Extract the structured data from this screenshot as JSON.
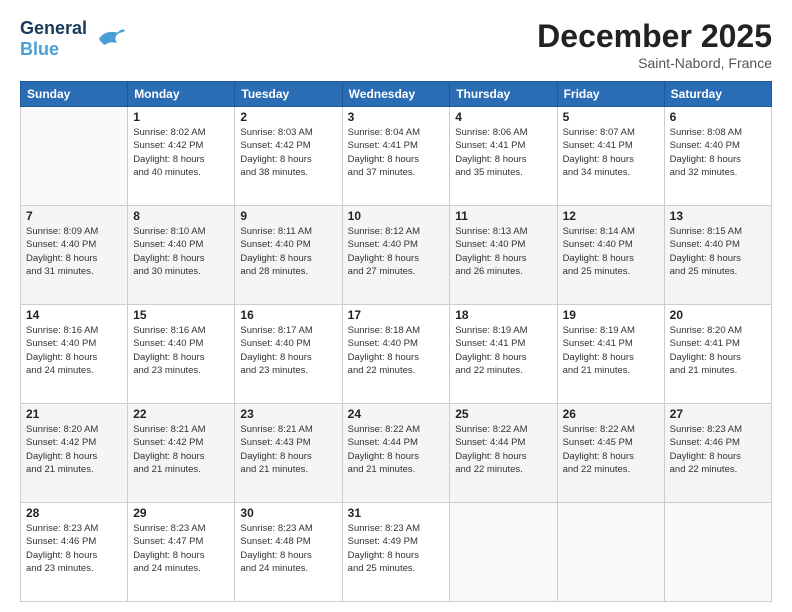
{
  "header": {
    "logo_line1": "General",
    "logo_line2": "Blue",
    "month": "December 2025",
    "location": "Saint-Nabord, France"
  },
  "weekdays": [
    "Sunday",
    "Monday",
    "Tuesday",
    "Wednesday",
    "Thursday",
    "Friday",
    "Saturday"
  ],
  "weeks": [
    [
      {
        "day": "",
        "info": ""
      },
      {
        "day": "1",
        "info": "Sunrise: 8:02 AM\nSunset: 4:42 PM\nDaylight: 8 hours\nand 40 minutes."
      },
      {
        "day": "2",
        "info": "Sunrise: 8:03 AM\nSunset: 4:42 PM\nDaylight: 8 hours\nand 38 minutes."
      },
      {
        "day": "3",
        "info": "Sunrise: 8:04 AM\nSunset: 4:41 PM\nDaylight: 8 hours\nand 37 minutes."
      },
      {
        "day": "4",
        "info": "Sunrise: 8:06 AM\nSunset: 4:41 PM\nDaylight: 8 hours\nand 35 minutes."
      },
      {
        "day": "5",
        "info": "Sunrise: 8:07 AM\nSunset: 4:41 PM\nDaylight: 8 hours\nand 34 minutes."
      },
      {
        "day": "6",
        "info": "Sunrise: 8:08 AM\nSunset: 4:40 PM\nDaylight: 8 hours\nand 32 minutes."
      }
    ],
    [
      {
        "day": "7",
        "info": "Sunrise: 8:09 AM\nSunset: 4:40 PM\nDaylight: 8 hours\nand 31 minutes."
      },
      {
        "day": "8",
        "info": "Sunrise: 8:10 AM\nSunset: 4:40 PM\nDaylight: 8 hours\nand 30 minutes."
      },
      {
        "day": "9",
        "info": "Sunrise: 8:11 AM\nSunset: 4:40 PM\nDaylight: 8 hours\nand 28 minutes."
      },
      {
        "day": "10",
        "info": "Sunrise: 8:12 AM\nSunset: 4:40 PM\nDaylight: 8 hours\nand 27 minutes."
      },
      {
        "day": "11",
        "info": "Sunrise: 8:13 AM\nSunset: 4:40 PM\nDaylight: 8 hours\nand 26 minutes."
      },
      {
        "day": "12",
        "info": "Sunrise: 8:14 AM\nSunset: 4:40 PM\nDaylight: 8 hours\nand 25 minutes."
      },
      {
        "day": "13",
        "info": "Sunrise: 8:15 AM\nSunset: 4:40 PM\nDaylight: 8 hours\nand 25 minutes."
      }
    ],
    [
      {
        "day": "14",
        "info": "Sunrise: 8:16 AM\nSunset: 4:40 PM\nDaylight: 8 hours\nand 24 minutes."
      },
      {
        "day": "15",
        "info": "Sunrise: 8:16 AM\nSunset: 4:40 PM\nDaylight: 8 hours\nand 23 minutes."
      },
      {
        "day": "16",
        "info": "Sunrise: 8:17 AM\nSunset: 4:40 PM\nDaylight: 8 hours\nand 23 minutes."
      },
      {
        "day": "17",
        "info": "Sunrise: 8:18 AM\nSunset: 4:40 PM\nDaylight: 8 hours\nand 22 minutes."
      },
      {
        "day": "18",
        "info": "Sunrise: 8:19 AM\nSunset: 4:41 PM\nDaylight: 8 hours\nand 22 minutes."
      },
      {
        "day": "19",
        "info": "Sunrise: 8:19 AM\nSunset: 4:41 PM\nDaylight: 8 hours\nand 21 minutes."
      },
      {
        "day": "20",
        "info": "Sunrise: 8:20 AM\nSunset: 4:41 PM\nDaylight: 8 hours\nand 21 minutes."
      }
    ],
    [
      {
        "day": "21",
        "info": "Sunrise: 8:20 AM\nSunset: 4:42 PM\nDaylight: 8 hours\nand 21 minutes."
      },
      {
        "day": "22",
        "info": "Sunrise: 8:21 AM\nSunset: 4:42 PM\nDaylight: 8 hours\nand 21 minutes."
      },
      {
        "day": "23",
        "info": "Sunrise: 8:21 AM\nSunset: 4:43 PM\nDaylight: 8 hours\nand 21 minutes."
      },
      {
        "day": "24",
        "info": "Sunrise: 8:22 AM\nSunset: 4:44 PM\nDaylight: 8 hours\nand 21 minutes."
      },
      {
        "day": "25",
        "info": "Sunrise: 8:22 AM\nSunset: 4:44 PM\nDaylight: 8 hours\nand 22 minutes."
      },
      {
        "day": "26",
        "info": "Sunrise: 8:22 AM\nSunset: 4:45 PM\nDaylight: 8 hours\nand 22 minutes."
      },
      {
        "day": "27",
        "info": "Sunrise: 8:23 AM\nSunset: 4:46 PM\nDaylight: 8 hours\nand 22 minutes."
      }
    ],
    [
      {
        "day": "28",
        "info": "Sunrise: 8:23 AM\nSunset: 4:46 PM\nDaylight: 8 hours\nand 23 minutes."
      },
      {
        "day": "29",
        "info": "Sunrise: 8:23 AM\nSunset: 4:47 PM\nDaylight: 8 hours\nand 24 minutes."
      },
      {
        "day": "30",
        "info": "Sunrise: 8:23 AM\nSunset: 4:48 PM\nDaylight: 8 hours\nand 24 minutes."
      },
      {
        "day": "31",
        "info": "Sunrise: 8:23 AM\nSunset: 4:49 PM\nDaylight: 8 hours\nand 25 minutes."
      },
      {
        "day": "",
        "info": ""
      },
      {
        "day": "",
        "info": ""
      },
      {
        "day": "",
        "info": ""
      }
    ]
  ]
}
